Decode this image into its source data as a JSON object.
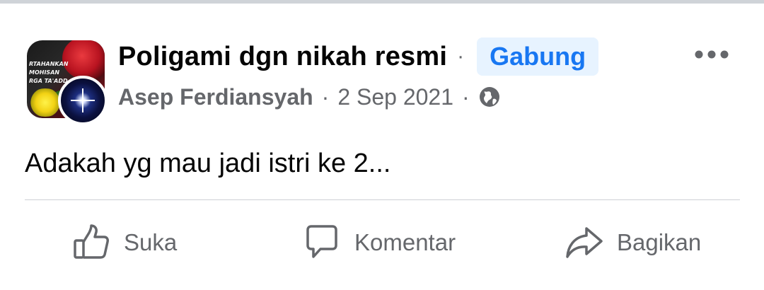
{
  "post": {
    "group_name": "Poligami dgn nikah resmi",
    "separator": "·",
    "join_label": "Gabung",
    "author": "Asep Ferdiansyah",
    "date": "2 Sep 2021",
    "content": "Adakah yg mau jadi istri ke 2..."
  },
  "group_avatar": {
    "text_line_1": "RTAHANKAN",
    "text_line_2": "MOHISAN",
    "text_line_3": "RGA TA'ADD"
  },
  "icons": {
    "globe": "globe-icon",
    "more": "more-options-icon",
    "like": "thumbs-up-icon",
    "comment": "comment-bubble-icon",
    "share": "share-arrow-icon"
  },
  "actions": {
    "like_label": "Suka",
    "comment_label": "Komentar",
    "share_label": "Bagikan"
  },
  "colors": {
    "accent": "#1877f2",
    "join_bg": "#e7f3ff",
    "secondary_text": "#65676b",
    "primary_text": "#050505",
    "divider": "#ced0d4"
  }
}
